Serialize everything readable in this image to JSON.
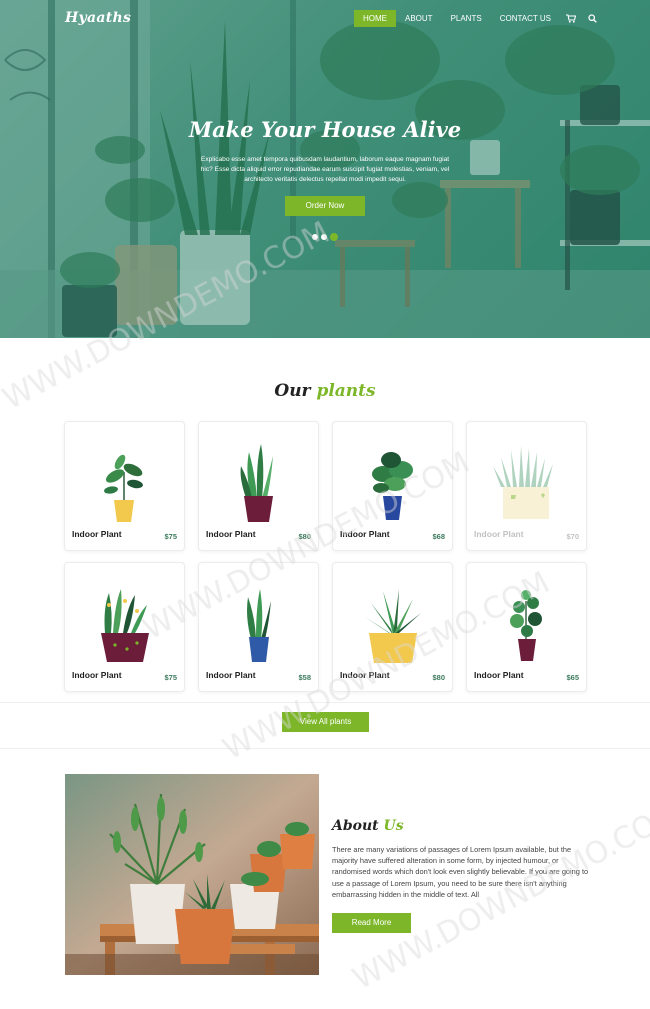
{
  "brand": "Hyaaths",
  "nav": {
    "items": [
      "HOME",
      "ABOUT",
      "PLANTS",
      "CONTACT US"
    ],
    "active": "HOME",
    "cart_icon": "cart-icon",
    "search_icon": "search-icon"
  },
  "hero": {
    "title": "Make Your House Alive",
    "text": "Explicabo esse amet tempora quibusdam laudantium, laborum eaque magnam fugiat hic? Esse dicta aliquid error repudiandae earum suscipit fugiat molestias, veniam, vel architecto veritatis delectus repellat modi impedit sequi.",
    "button": "Order Now",
    "slides": 3,
    "active_slide": 3
  },
  "plants": {
    "title_main": "Our",
    "title_accent": "plants",
    "items": [
      {
        "name": "Indoor Plant",
        "price": "$75"
      },
      {
        "name": "Indoor Plant",
        "price": "$80"
      },
      {
        "name": "Indoor Plant",
        "price": "$68"
      },
      {
        "name": "Indoor Plant",
        "price": "$70"
      },
      {
        "name": "Indoor Plant",
        "price": "$75"
      },
      {
        "name": "Indoor Plant",
        "price": "$58"
      },
      {
        "name": "Indoor Plant",
        "price": "$80"
      },
      {
        "name": "Indoor Plant",
        "price": "$65"
      }
    ],
    "view_all": "View All plants"
  },
  "about": {
    "title_main": "About",
    "title_accent": "Us",
    "text": "There are many variations of passages of Lorem Ipsum available, but the majority have suffered alteration in some form, by injected humour, or randomised words which don't look even slightly believable. If you are going to use a passage of Lorem Ipsum, you need to be sure there isn't anything embarrassing hidden in the middle of text. All",
    "button": "Read More"
  },
  "watermark": "WWW.DOWNDEMO.COM",
  "colors": {
    "accent": "#7db729",
    "hero_overlay": "#167860",
    "price": "#3d7a5e"
  }
}
